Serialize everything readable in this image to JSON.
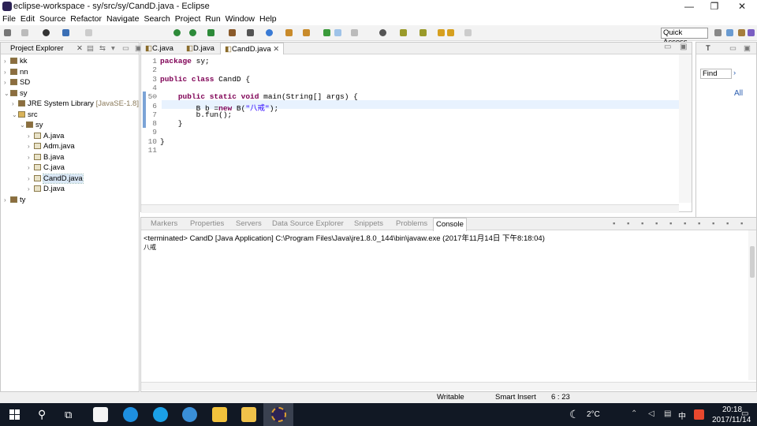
{
  "window": {
    "title": "eclipse-workspace - sy/src/sy/CandD.java - Eclipse",
    "minimize": "—",
    "maximize": "❐",
    "close": "✕"
  },
  "menu": [
    "File",
    "Edit",
    "Source",
    "Refactor",
    "Navigate",
    "Search",
    "Project",
    "Run",
    "Window",
    "Help"
  ],
  "toolbar": {
    "quick_access": "Quick Access"
  },
  "project_explorer": {
    "title": "Project Explorer",
    "tree": [
      {
        "label": "kk",
        "indent": 0,
        "arrow": "›"
      },
      {
        "label": "nn",
        "indent": 0,
        "arrow": "›"
      },
      {
        "label": "SD",
        "indent": 0,
        "arrow": "›"
      },
      {
        "label": "sy",
        "indent": 0,
        "arrow": "⌄"
      },
      {
        "label": "JRE System Library",
        "extra": "[JavaSE-1.8]",
        "indent": 1,
        "arrow": "›"
      },
      {
        "label": "src",
        "indent": 1,
        "arrow": "⌄"
      },
      {
        "label": "sy",
        "indent": 2,
        "arrow": "⌄"
      },
      {
        "label": "A.java",
        "indent": 3,
        "arrow": "›"
      },
      {
        "label": "Adm.java",
        "indent": 3,
        "arrow": "›"
      },
      {
        "label": "B.java",
        "indent": 3,
        "arrow": "›"
      },
      {
        "label": "C.java",
        "indent": 3,
        "arrow": "›"
      },
      {
        "label": "CandD.java",
        "indent": 3,
        "arrow": "›",
        "selected": true
      },
      {
        "label": "D.java",
        "indent": 3,
        "arrow": "›"
      },
      {
        "label": "ty",
        "indent": 0,
        "arrow": "›"
      }
    ]
  },
  "editor": {
    "tabs": [
      "C.java",
      "D.java",
      "CandD.java"
    ],
    "active_tab": "CandD.java",
    "close_glyph": "✕",
    "lines": [
      {
        "n": "1",
        "html": "<span class='kw'>package</span> sy;"
      },
      {
        "n": "2",
        "html": ""
      },
      {
        "n": "3",
        "html": "<span class='kw'>public class</span> CandD {"
      },
      {
        "n": "4",
        "html": ""
      },
      {
        "n": "5⊖",
        "html": "    <span class='kw'>public static void</span> main(String[] args) {"
      },
      {
        "n": "6",
        "html": "        B b =<span class='kw'>new</span> B(<span class='str'>\"八戒\"</span>);"
      },
      {
        "n": "7",
        "html": "        b.fun();"
      },
      {
        "n": "8",
        "html": "    }"
      },
      {
        "n": "9",
        "html": ""
      },
      {
        "n": "10",
        "html": "}"
      },
      {
        "n": "11",
        "html": ""
      }
    ]
  },
  "outline": {
    "tab": "T",
    "find": "Find",
    "all": "All"
  },
  "bottom_panel": {
    "tabs": [
      "Markers",
      "Properties",
      "Servers",
      "Data Source Explorer",
      "Snippets",
      "Problems",
      "Console"
    ],
    "active_tab": "Console",
    "status": "<terminated> CandD [Java Application] C:\\Program Files\\Java\\jre1.8.0_144\\bin\\javaw.exe (2017年11月14日 下午8:18:04)",
    "output": "八戒"
  },
  "status_bar": {
    "mode": "Writable",
    "insert": "Smart Insert",
    "position": "6 : 23"
  },
  "taskbar": {
    "weather": "2°C",
    "ime": "中",
    "time": "20:18",
    "date": "2017/11/14",
    "colors": {
      "bg": "#111824"
    }
  }
}
